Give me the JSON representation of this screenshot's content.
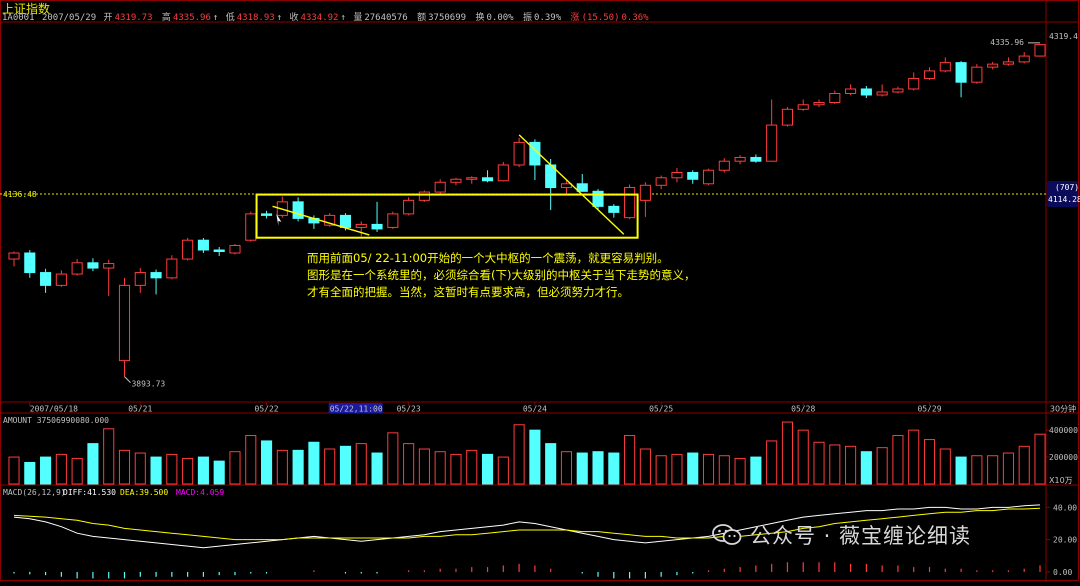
{
  "header": {
    "title": "上证指数",
    "code": "1A0001",
    "date": "2007/05/29",
    "open_label": "开",
    "open": "4319.73",
    "high_label": "高",
    "high": "4335.96",
    "low_label": "低",
    "low": "4318.93",
    "close_label": "收",
    "close": "4334.92",
    "volume_label": "量",
    "volume": "27640576",
    "amount_label": "额",
    "amount": "3750699",
    "turnover_label": "换",
    "turnover": "0.00%",
    "amplitude_label": "振",
    "amplitude": "0.39%",
    "change_label": "涨",
    "change": "(15.50)",
    "change_pct": "0.36%"
  },
  "annotation": {
    "lines": [
      "而用前面05/ 22-11:00开始的一个大中枢的一个震荡，就更容易判别。",
      "图形是在一个系统里的，必须综合看(下)大级别的中枢关于当下走势的意义，",
      "才有全面的把握。当然，这暂时有点要求高，但必须努力才行。"
    ]
  },
  "watermark": {
    "text": "公众号 · 薇宝缠论细读"
  },
  "colors": {
    "up": "#ff3c3c",
    "down": "#54ffff",
    "grid": "#8b0000",
    "annotation": "#ffff00",
    "dashed_level": "#e8e800",
    "dif_line": "#ffffff",
    "dea_line": "#ffff00",
    "macd_label": "#ff00ff"
  },
  "chart_data": [
    {
      "type": "candlestick",
      "title": "上证指数",
      "period_label": "30分钟",
      "ylim": [
        3860,
        4365
      ],
      "right_axis_labels": [
        "4319.4",
        "(707)",
        "4114.28"
      ],
      "dashed_level": 4136.48,
      "dashed_level_label": "4136.48",
      "high_marker_label": "4335.96",
      "low_marker_label": "3893.73",
      "x_ticks": [
        "2007/05/18",
        "05/21",
        "05/22",
        "05/22,11:00",
        "05/23",
        "05/24",
        "05/25",
        "05/28",
        "05/29"
      ],
      "x_tick_index": [
        1,
        8,
        16,
        20,
        25,
        33,
        41,
        50,
        58
      ],
      "candles": [
        {
          "o": 4050,
          "h": 4060,
          "l": 4040,
          "c": 4058
        },
        {
          "o": 4058,
          "h": 4062,
          "l": 4025,
          "c": 4032
        },
        {
          "o": 4032,
          "h": 4037,
          "l": 4005,
          "c": 4015
        },
        {
          "o": 4015,
          "h": 4035,
          "l": 4013,
          "c": 4030
        },
        {
          "o": 4030,
          "h": 4050,
          "l": 4028,
          "c": 4045
        },
        {
          "o": 4045,
          "h": 4051,
          "l": 4034,
          "c": 4038
        },
        {
          "o": 4038,
          "h": 4049,
          "l": 4001,
          "c": 4044
        },
        {
          "o": 3915,
          "h": 4025,
          "l": 3893.73,
          "c": 4015
        },
        {
          "o": 4015,
          "h": 4038,
          "l": 4005,
          "c": 4032
        },
        {
          "o": 4032,
          "h": 4036,
          "l": 4003,
          "c": 4025
        },
        {
          "o": 4025,
          "h": 4055,
          "l": 4023,
          "c": 4050
        },
        {
          "o": 4050,
          "h": 4078,
          "l": 4048,
          "c": 4075
        },
        {
          "o": 4075,
          "h": 4078,
          "l": 4058,
          "c": 4062
        },
        {
          "o": 4062,
          "h": 4066,
          "l": 4054,
          "c": 4060
        },
        {
          "o": 4058,
          "h": 4070,
          "l": 4056,
          "c": 4068
        },
        {
          "o": 4075,
          "h": 4113,
          "l": 4073,
          "c": 4110
        },
        {
          "o": 4110,
          "h": 4114,
          "l": 4104,
          "c": 4108
        },
        {
          "o": 4108,
          "h": 4133,
          "l": 4105,
          "c": 4126
        },
        {
          "o": 4126,
          "h": 4132,
          "l": 4100,
          "c": 4104
        },
        {
          "o": 4104,
          "h": 4108,
          "l": 4090,
          "c": 4098
        },
        {
          "o": 4095,
          "h": 4111,
          "l": 4093,
          "c": 4108
        },
        {
          "o": 4108,
          "h": 4111,
          "l": 4088,
          "c": 4092
        },
        {
          "o": 4092,
          "h": 4100,
          "l": 4080,
          "c": 4096
        },
        {
          "o": 4096,
          "h": 4126,
          "l": 4086,
          "c": 4090
        },
        {
          "o": 4092,
          "h": 4113,
          "l": 4090,
          "c": 4110
        },
        {
          "o": 4110,
          "h": 4132,
          "l": 4108,
          "c": 4128
        },
        {
          "o": 4128,
          "h": 4141,
          "l": 4126,
          "c": 4139
        },
        {
          "o": 4139,
          "h": 4156,
          "l": 4137,
          "c": 4152
        },
        {
          "o": 4152,
          "h": 4158,
          "l": 4148,
          "c": 4156
        },
        {
          "o": 4156,
          "h": 4160,
          "l": 4150,
          "c": 4158
        },
        {
          "o": 4158,
          "h": 4168,
          "l": 4152,
          "c": 4154
        },
        {
          "o": 4154,
          "h": 4179,
          "l": 4153,
          "c": 4175
        },
        {
          "o": 4175,
          "h": 4211,
          "l": 4172,
          "c": 4205
        },
        {
          "o": 4205,
          "h": 4209,
          "l": 4155,
          "c": 4175
        },
        {
          "o": 4175,
          "h": 4183,
          "l": 4115,
          "c": 4145
        },
        {
          "o": 4145,
          "h": 4154,
          "l": 4137,
          "c": 4150
        },
        {
          "o": 4150,
          "h": 4163,
          "l": 4142,
          "c": 4140
        },
        {
          "o": 4140,
          "h": 4143,
          "l": 4115,
          "c": 4120
        },
        {
          "o": 4120,
          "h": 4123,
          "l": 4105,
          "c": 4112
        },
        {
          "o": 4105,
          "h": 4149,
          "l": 4103,
          "c": 4145
        },
        {
          "o": 4128,
          "h": 4152,
          "l": 4106,
          "c": 4148
        },
        {
          "o": 4148,
          "h": 4161,
          "l": 4143,
          "c": 4158
        },
        {
          "o": 4158,
          "h": 4171,
          "l": 4152,
          "c": 4165
        },
        {
          "o": 4165,
          "h": 4168,
          "l": 4150,
          "c": 4156
        },
        {
          "o": 4150,
          "h": 4170,
          "l": 4148,
          "c": 4168
        },
        {
          "o": 4168,
          "h": 4184,
          "l": 4165,
          "c": 4180
        },
        {
          "o": 4180,
          "h": 4188,
          "l": 4176,
          "c": 4185
        },
        {
          "o": 4185,
          "h": 4189,
          "l": 4178,
          "c": 4180
        },
        {
          "o": 4180,
          "h": 4262,
          "l": 4200,
          "c": 4228
        },
        {
          "o": 4228,
          "h": 4252,
          "l": 4226,
          "c": 4249
        },
        {
          "o": 4249,
          "h": 4262,
          "l": 4247,
          "c": 4255
        },
        {
          "o": 4255,
          "h": 4262,
          "l": 4252,
          "c": 4258
        },
        {
          "o": 4258,
          "h": 4274,
          "l": 4256,
          "c": 4270
        },
        {
          "o": 4270,
          "h": 4282,
          "l": 4268,
          "c": 4276
        },
        {
          "o": 4276,
          "h": 4280,
          "l": 4264,
          "c": 4268
        },
        {
          "o": 4268,
          "h": 4282,
          "l": 4266,
          "c": 4272
        },
        {
          "o": 4272,
          "h": 4279,
          "l": 4270,
          "c": 4276
        },
        {
          "o": 4276,
          "h": 4298,
          "l": 4274,
          "c": 4290
        },
        {
          "o": 4290,
          "h": 4305,
          "l": 4288,
          "c": 4300
        },
        {
          "o": 4300,
          "h": 4318,
          "l": 4298,
          "c": 4311
        },
        {
          "o": 4311,
          "h": 4313,
          "l": 4265,
          "c": 4285
        },
        {
          "o": 4285,
          "h": 4309,
          "l": 4283,
          "c": 4305
        },
        {
          "o": 4305,
          "h": 4312,
          "l": 4302,
          "c": 4309
        },
        {
          "o": 4309,
          "h": 4318,
          "l": 4307,
          "c": 4312
        },
        {
          "o": 4312,
          "h": 4325,
          "l": 4310,
          "c": 4319.73
        },
        {
          "o": 4319.73,
          "h": 4335.96,
          "l": 4318.93,
          "c": 4334.92
        }
      ]
    },
    {
      "type": "bar",
      "title": "AMOUNT",
      "label": "AMOUNT 37506990080.000",
      "unit_label": "X10万",
      "ylim": [
        0,
        520000
      ],
      "y_ticks": [
        400000,
        200000
      ],
      "y_tick_labels": [
        "400000",
        "200000"
      ],
      "values": [
        200000,
        160000,
        200000,
        220000,
        190000,
        300000,
        410000,
        250000,
        230000,
        200000,
        220000,
        190000,
        200000,
        170000,
        240000,
        360000,
        320000,
        250000,
        250000,
        310000,
        260000,
        280000,
        300000,
        230000,
        380000,
        300000,
        260000,
        240000,
        220000,
        250000,
        220000,
        200000,
        440000,
        400000,
        300000,
        240000,
        230000,
        240000,
        230000,
        360000,
        260000,
        210000,
        220000,
        230000,
        220000,
        210000,
        190000,
        200000,
        320000,
        460000,
        400000,
        310000,
        290000,
        280000,
        240000,
        270000,
        360000,
        400000,
        330000,
        260000,
        200000,
        210000,
        210000,
        230000,
        280000,
        370000
      ]
    },
    {
      "type": "line",
      "title": "MACD(26,12,9)",
      "diff_label": "DIFF:41.530",
      "dea_label": "DEA:39.500",
      "macd_label": "MACD:4.059",
      "ylim": [
        -5,
        52
      ],
      "y_ticks": [
        40,
        20,
        0
      ],
      "y_tick_labels": [
        "40.00",
        "20.00",
        "0.00"
      ],
      "series": [
        {
          "name": "DIFF",
          "values": [
            34,
            33,
            31,
            28,
            24,
            22,
            21,
            20,
            19,
            18,
            17,
            16,
            15,
            16,
            17,
            18,
            19,
            20,
            21,
            22,
            21,
            20,
            19,
            20,
            21,
            22,
            23,
            25,
            26,
            27,
            28,
            29,
            31,
            30,
            28,
            26,
            24,
            22,
            20,
            19,
            18,
            19,
            20,
            21,
            22,
            24,
            26,
            28,
            30,
            32,
            34,
            35,
            36,
            37,
            38,
            38,
            39,
            39,
            40,
            40,
            39,
            39,
            40,
            40,
            41,
            41.53
          ]
        },
        {
          "name": "DEA",
          "values": [
            35,
            34.5,
            34,
            33,
            32,
            30,
            29,
            27,
            26,
            25,
            24,
            23,
            22,
            21,
            20,
            20,
            20,
            20,
            21,
            21,
            21,
            21,
            21,
            21,
            21,
            21,
            22,
            22,
            23,
            23,
            24,
            25,
            26,
            26,
            26,
            26,
            25,
            25,
            24,
            23,
            22,
            22,
            21,
            21,
            21,
            22,
            22,
            23,
            24,
            25,
            27,
            28,
            30,
            31,
            32,
            33,
            34,
            35,
            36,
            37,
            37,
            38,
            38,
            39,
            39,
            39.5
          ]
        }
      ],
      "hist": [
        -1,
        -1.5,
        -2,
        -3,
        -4,
        -4,
        -4,
        -4,
        -3,
        -3,
        -3,
        -3,
        -3,
        -2,
        -2,
        -1,
        -1,
        0,
        0,
        1,
        0,
        -1,
        -1,
        -1,
        0,
        1,
        1,
        2,
        2,
        3,
        3,
        4,
        5,
        4,
        2,
        0,
        -1,
        -3,
        -4,
        -4,
        -4,
        -3,
        -2,
        -1,
        1,
        2,
        3,
        4,
        5,
        6,
        6,
        6,
        6,
        5,
        5,
        4,
        4,
        3,
        3,
        2,
        2,
        1,
        1,
        1,
        2,
        4.059
      ]
    }
  ]
}
